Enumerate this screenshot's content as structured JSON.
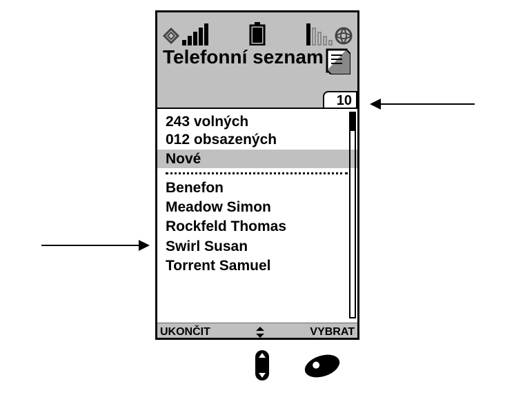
{
  "title": "Telefonní seznam",
  "tab_count": "10",
  "status": {
    "free": "243 volných",
    "used": "012 obsazených"
  },
  "selected_item": "Nové",
  "contacts": [
    "Benefon",
    "Meadow Simon",
    "Rockfeld Thomas",
    "Swirl Susan",
    "Torrent Samuel"
  ],
  "softkeys": {
    "left": "UKONČIT",
    "right": "VYBRAT"
  }
}
